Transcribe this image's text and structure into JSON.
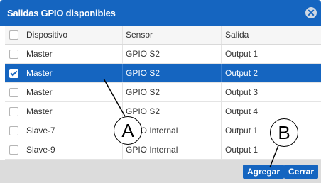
{
  "dialog": {
    "title": "Salidas GPIO disponibles",
    "close_icon": "close-circle-icon"
  },
  "table": {
    "columns": [
      "Dispositivo",
      "Sensor",
      "Salida"
    ],
    "rows": [
      {
        "device": "Master",
        "sensor": "GPIO S2",
        "output": "Output 1",
        "checked": false,
        "selected": false
      },
      {
        "device": "Master",
        "sensor": "GPIO S2",
        "output": "Output 2",
        "checked": true,
        "selected": true
      },
      {
        "device": "Master",
        "sensor": "GPIO S2",
        "output": "Output 3",
        "checked": false,
        "selected": false
      },
      {
        "device": "Master",
        "sensor": "GPIO S2",
        "output": "Output 4",
        "checked": false,
        "selected": false
      },
      {
        "device": "Slave-7",
        "sensor": "GPIO Internal",
        "output": "Output 1",
        "checked": false,
        "selected": false
      },
      {
        "device": "Slave-9",
        "sensor": "GPIO Internal",
        "output": "Output 1",
        "checked": false,
        "selected": false
      }
    ]
  },
  "footer": {
    "add_label": "Agregar",
    "close_label": "Cerrar"
  },
  "callouts": {
    "a": "A",
    "b": "B"
  },
  "colors": {
    "accent": "#1565c0",
    "footer_bg": "#dcdcdc"
  }
}
